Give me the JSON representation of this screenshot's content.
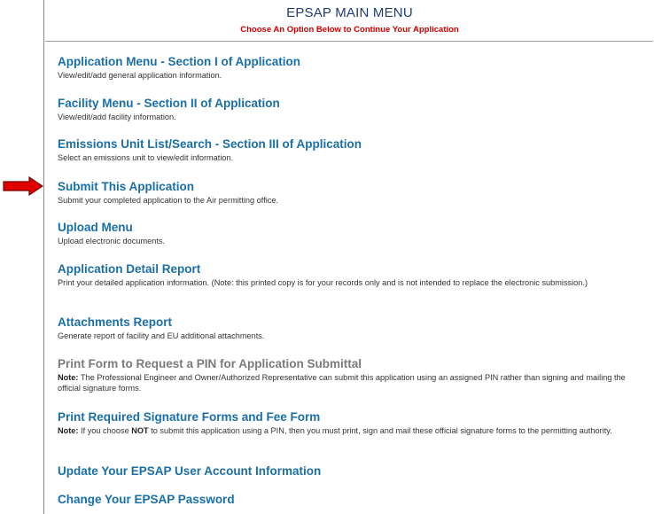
{
  "header": {
    "title": "EPSAP MAIN MENU",
    "subtitle": "Choose An Option Below to Continue Your Application"
  },
  "menu": [
    {
      "label": "Application Menu - Section I of Application",
      "desc": "View/edit/add general application information."
    },
    {
      "label": "Facility Menu - Section II of Application",
      "desc": "View/edit/add facility information."
    },
    {
      "label": "Emissions Unit List/Search - Section III of Application",
      "desc": "Select an emissions unit to view/edit information."
    },
    {
      "label": "Submit This Application",
      "desc": "Submit your completed application to the Air permitting office."
    },
    {
      "label": "Upload Menu",
      "desc": "Upload electronic documents."
    },
    {
      "label": "Application Detail Report",
      "desc": "Print your detailed application information. (Note: this printed copy is for your records only and is not intended to replace the electronic submission.)"
    },
    {
      "label": "Attachments Report",
      "desc": "Generate report of facility and EU additional attachments."
    },
    {
      "label": "Print Form to Request a PIN for Application Submittal",
      "note_label": "Note:",
      "desc": " The Professional Engineer and Owner/Authorized Representative can submit this application using an assigned PIN rather than signing and mailing the official signature forms."
    },
    {
      "label": "Print Required Signature Forms and Fee Form",
      "note_label": "Note:",
      "desc_pre": " If you choose ",
      "desc_emph": "NOT",
      "desc": " to submit this application using a PIN, then you must print, sign and mail these official signature forms to the permitting authority."
    },
    {
      "label": "Update Your EPSAP User Account Information"
    },
    {
      "label": "Change Your EPSAP Password"
    }
  ],
  "pointer": {
    "icon": "red-arrow-icon",
    "color": "#e00000"
  }
}
